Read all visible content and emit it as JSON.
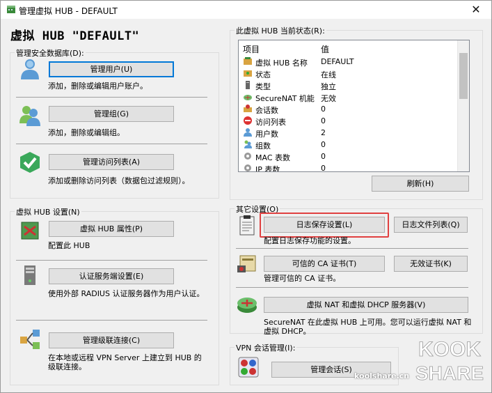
{
  "window": {
    "title": "管理虚拟 HUB - DEFAULT",
    "close": "✕"
  },
  "header": {
    "title": "虚拟 HUB \"DEFAULT\""
  },
  "security_db": {
    "label": "管理安全数据库(D):",
    "users_btn": "管理用户(U)",
    "users_desc": "添加，删除或编辑用户账户。",
    "groups_btn": "管理组(G)",
    "groups_desc": "添加，删除或编辑组。",
    "acl_btn": "管理访问列表(A)",
    "acl_desc": "添加或删除访问列表（数据包过滤规则）。"
  },
  "hub_settings": {
    "label": "虚拟 HUB 设置(N)",
    "props_btn": "虚拟 HUB 属性(P)",
    "props_desc": "配置此 HUB",
    "auth_btn": "认证服务端设置(E)",
    "auth_desc": "使用外部 RADIUS 认证服务器作为用户认证。",
    "cascade_btn": "管理级联连接(C)",
    "cascade_desc": "在本地或远程 VPN Server 上建立到 HUB 的级联连接。"
  },
  "status": {
    "label": "此虚拟 HUB 当前状态(R):",
    "col_item": "项目",
    "col_value": "值",
    "rows": [
      {
        "key": "虚拟 HUB 名称",
        "value": "DEFAULT",
        "icon": "hub-icon"
      },
      {
        "key": "状态",
        "value": "在线",
        "icon": "status-icon"
      },
      {
        "key": "类型",
        "value": "独立",
        "icon": "server-icon"
      },
      {
        "key": "SecureNAT 机能",
        "value": "无效",
        "icon": "router-icon"
      },
      {
        "key": "会话数",
        "value": "0",
        "icon": "session-icon"
      },
      {
        "key": "访问列表",
        "value": "0",
        "icon": "block-icon"
      },
      {
        "key": "用户数",
        "value": "2",
        "icon": "user-icon"
      },
      {
        "key": "组数",
        "value": "0",
        "icon": "group-icon"
      },
      {
        "key": "MAC 表数",
        "value": "0",
        "icon": "gear-icon"
      },
      {
        "key": "IP 表数",
        "value": "0",
        "icon": "gear-icon"
      }
    ],
    "refresh_btn": "刷新(H)"
  },
  "other": {
    "label": "其它设置(O)",
    "log_btn": "日志保存设置(L)",
    "logfiles_btn": "日志文件列表(Q)",
    "log_desc": "配置日志保存功能的设置。",
    "ca_btn": "可信的 CA 证书(T)",
    "crl_btn": "无效证书(K)",
    "ca_desc": "管理可信的 CA 证书。",
    "nat_btn": "虚拟 NAT 和虚拟 DHCP 服务器(V)",
    "nat_desc": "SecureNAT 在此虚拟 HUB 上可用。您可以运行虚拟 NAT 和虚拟 DHCP。"
  },
  "sessions": {
    "label": "VPN 会话管理(I):",
    "btn": "管理会话(S)"
  },
  "watermark": {
    "text": "koolshare.cn"
  }
}
